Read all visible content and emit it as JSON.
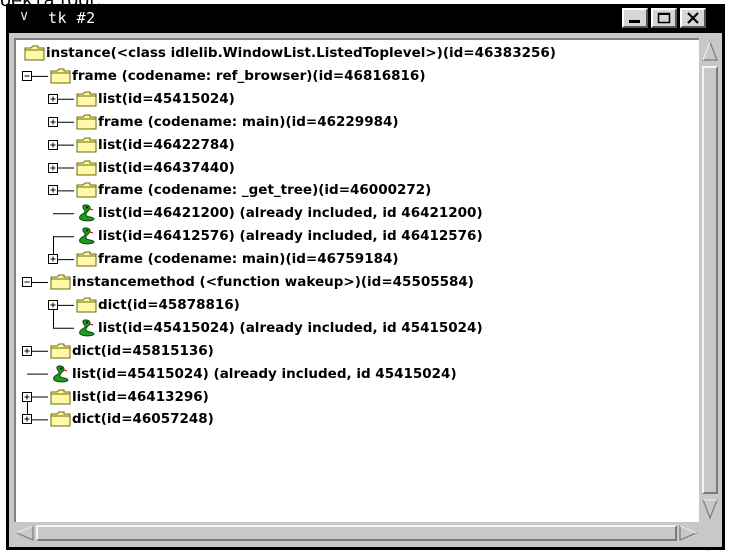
{
  "fragments": {
    "top": "оекта root:",
    "bottom": "→"
  },
  "window": {
    "title": "tk #2",
    "buttons": {
      "minimize": "minimize",
      "maximize": "maximize",
      "close": "close"
    }
  },
  "tree": {
    "nodes": [
      {
        "label": "instance(<class idlelib.WindowList.ListedToplevel>)(id=46383256)",
        "level": 0,
        "icon": "folder-icon",
        "expander": "none"
      },
      {
        "label": "frame (codename: ref_browser)(id=46816816)",
        "level": 1,
        "icon": "folder-icon",
        "expander": "minus"
      },
      {
        "label": "list(id=45415024)",
        "level": 2,
        "icon": "folder-icon",
        "expander": "plus"
      },
      {
        "label": "frame (codename: main)(id=46229984)",
        "level": 2,
        "icon": "folder-icon",
        "expander": "plus"
      },
      {
        "label": "list(id=46422784)",
        "level": 2,
        "icon": "folder-icon",
        "expander": "plus"
      },
      {
        "label": "list(id=46437440)",
        "level": 2,
        "icon": "folder-icon",
        "expander": "plus"
      },
      {
        "label": "frame (codename: _get_tree)(id=46000272)",
        "level": 2,
        "icon": "folder-icon",
        "expander": "plus"
      },
      {
        "label": "list(id=46421200) (already included, id 46421200)",
        "level": 2,
        "icon": "python-icon",
        "expander": "none"
      },
      {
        "label": "list(id=46412576) (already included, id 46412576)",
        "level": 2,
        "icon": "python-icon",
        "expander": "none"
      },
      {
        "label": "frame (codename: main)(id=46759184)",
        "level": 2,
        "icon": "folder-icon",
        "expander": "plus"
      },
      {
        "label": "instancemethod (<function wakeup>)(id=45505584)",
        "level": 1,
        "icon": "folder-icon",
        "expander": "minus"
      },
      {
        "label": "dict(id=45878816)",
        "level": 2,
        "icon": "folder-icon",
        "expander": "plus"
      },
      {
        "label": "list(id=45415024) (already included, id 45415024)",
        "level": 2,
        "icon": "python-icon",
        "expander": "none"
      },
      {
        "label": "dict(id=45815136)",
        "level": 1,
        "icon": "folder-icon",
        "expander": "plus"
      },
      {
        "label": "list(id=45415024) (already included, id 45415024)",
        "level": 1,
        "icon": "python-icon",
        "expander": "none"
      },
      {
        "label": "list(id=46413296)",
        "level": 1,
        "icon": "folder-icon",
        "expander": "plus"
      },
      {
        "label": "dict(id=46057248)",
        "level": 1,
        "icon": "folder-icon",
        "expander": "plus"
      }
    ]
  },
  "colors": {
    "folder_fill": "#fff8a8",
    "folder_stroke": "#6b6b00",
    "python_green": "#1e9a1e",
    "python_dark": "#0a4a0a",
    "chrome": "#c8c8c8"
  }
}
